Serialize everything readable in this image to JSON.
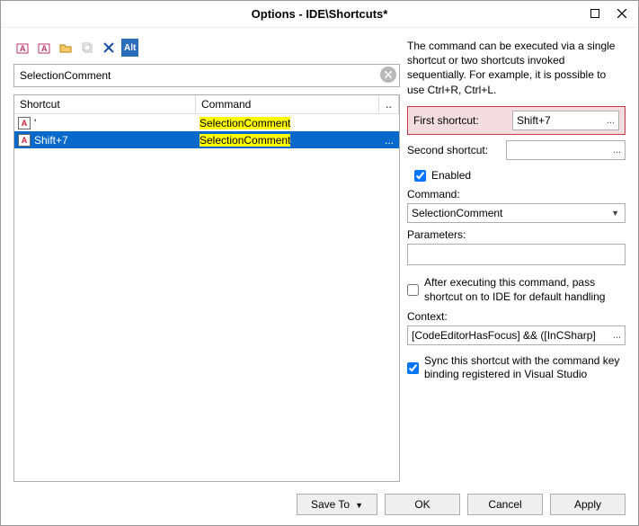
{
  "window": {
    "title": "Options - IDE\\Shortcuts*"
  },
  "toolbar": {
    "alt_label": "Alt"
  },
  "search": {
    "value": "SelectionComment"
  },
  "table": {
    "headers": {
      "shortcut": "Shortcut",
      "command": "Command",
      "extra": ".."
    },
    "rows": [
      {
        "shortcut": "'",
        "command": "SelectionComment",
        "selected": false
      },
      {
        "shortcut": "Shift+7",
        "command": "SelectionComment",
        "selected": true
      }
    ]
  },
  "right": {
    "desc": "The command can be executed via a single shortcut or two shortcuts invoked sequentially. For example, it is possible to use Ctrl+R, Ctrl+L.",
    "first_label": "First shortcut:",
    "first_value": "Shift+7",
    "second_label": "Second shortcut:",
    "second_value": "",
    "enabled_label": "Enabled",
    "command_label": "Command:",
    "command_value": "SelectionComment",
    "params_label": "Parameters:",
    "params_value": "",
    "pass_label": "After executing this command, pass shortcut on to IDE for default handling",
    "context_label": "Context:",
    "context_value": "[CodeEditorHasFocus] && ([InCSharp]",
    "context_ellipsis": "...",
    "sync_label": "Sync this shortcut with the command key binding registered in Visual Studio"
  },
  "footer": {
    "saveto": "Save To",
    "ok": "OK",
    "cancel": "Cancel",
    "apply": "Apply"
  }
}
